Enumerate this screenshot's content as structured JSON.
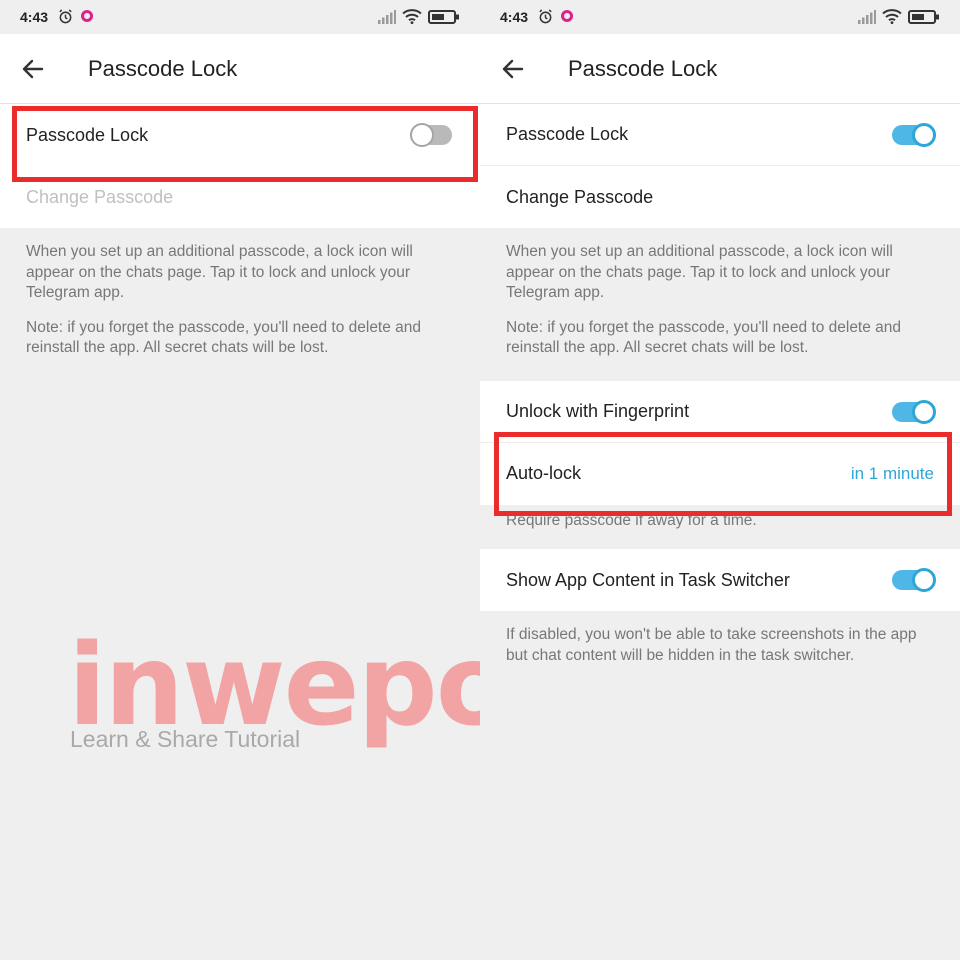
{
  "status_bar": {
    "time": "4:43",
    "icons": [
      "alarm-icon",
      "notification-icon",
      "signal-icon",
      "wifi-icon",
      "battery-icon"
    ]
  },
  "left": {
    "title": "Passcode Lock",
    "rows": {
      "passcode_lock": {
        "label": "Passcode Lock",
        "toggle": "off"
      },
      "change_passcode": {
        "label": "Change Passcode",
        "disabled": true
      }
    },
    "info": [
      "When you set up an additional passcode, a lock icon will appear on the chats page. Tap it to lock and unlock your Telegram app.",
      "Note: if you forget the passcode, you'll need to delete and reinstall the app. All secret chats will be lost."
    ]
  },
  "right": {
    "title": "Passcode Lock",
    "rows": {
      "passcode_lock": {
        "label": "Passcode Lock",
        "toggle": "on"
      },
      "change_passcode": {
        "label": "Change Passcode"
      },
      "fingerprint": {
        "label": "Unlock with Fingerprint",
        "toggle": "on"
      },
      "autolock": {
        "label": "Auto-lock",
        "value": "in 1 minute"
      },
      "task_switcher": {
        "label": "Show App Content in Task Switcher",
        "toggle": "on"
      }
    },
    "info": [
      "When you set up an additional passcode, a lock icon will appear on the chats page. Tap it to lock and unlock your Telegram app.",
      "Note: if you forget the passcode, you'll need to delete and reinstall the app. All secret chats will be lost."
    ],
    "autolock_hint": "Require passcode if away for a time.",
    "task_switcher_hint": "If disabled, you won't be able to take screenshots in the app but chat content will be hidden in the task switcher."
  },
  "watermark": {
    "brand": "inwepo",
    "tagline": "Learn & Share Tutorial"
  },
  "colors": {
    "accent": "#2ea6d6",
    "highlight": "#ea2c2c",
    "background": "#efefef",
    "watermark": "#f2a3a3"
  }
}
